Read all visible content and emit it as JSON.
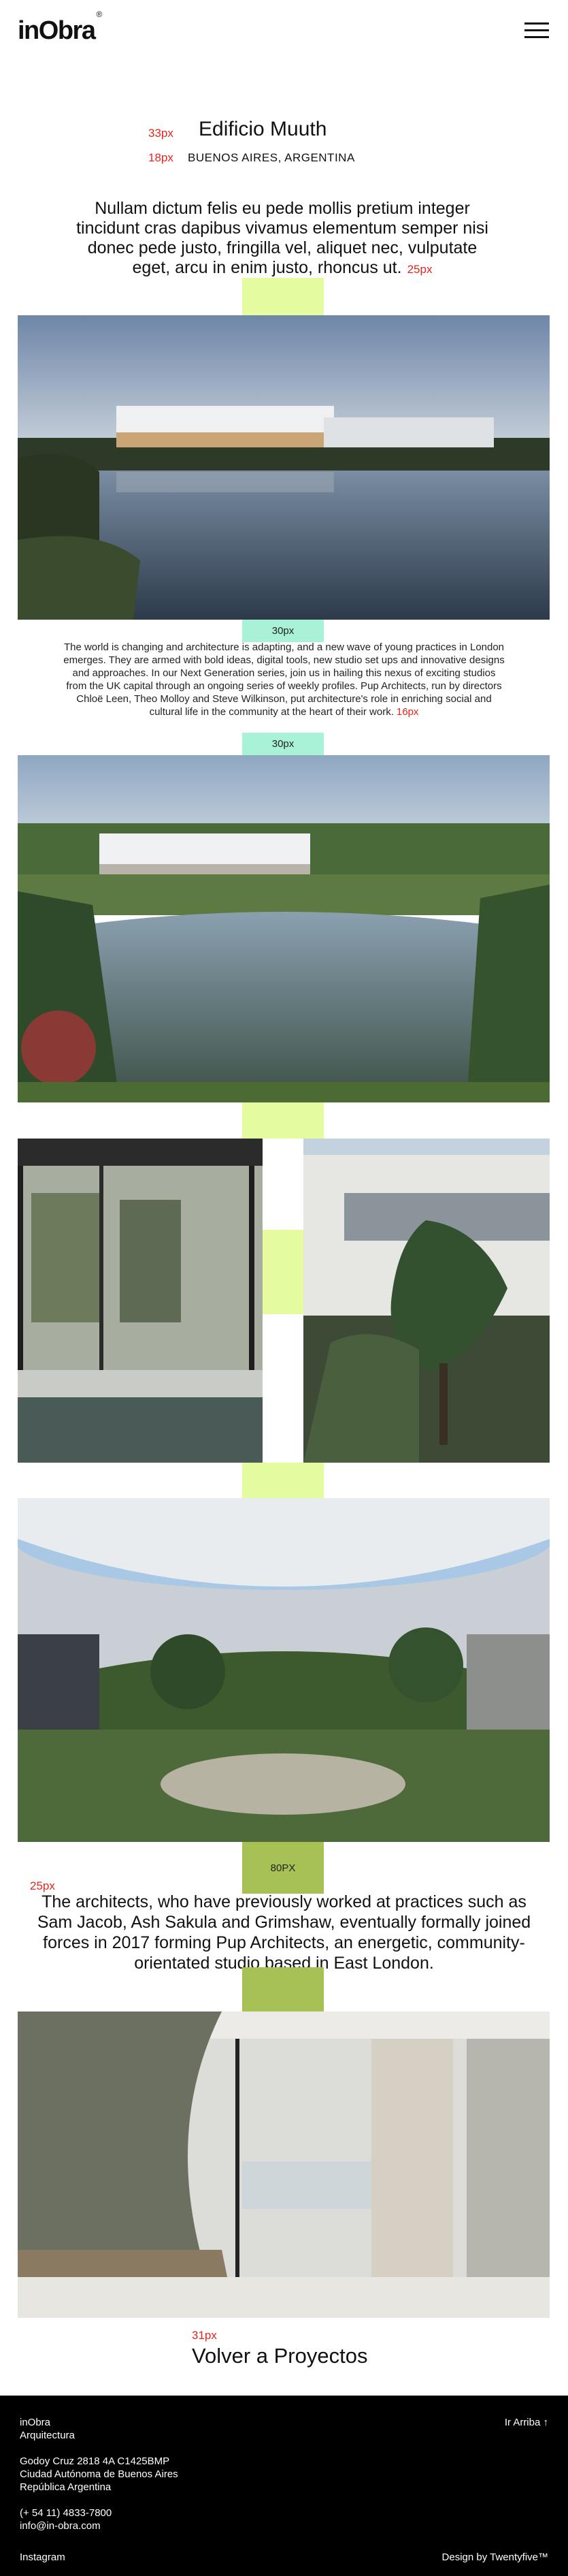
{
  "header": {
    "logo": "inObra",
    "logo_mark": "®",
    "menu_icon": "hamburger-menu-icon"
  },
  "annotations": {
    "title_size": "33px",
    "location_size": "18px",
    "lead_size": "25px",
    "body_size": "16px",
    "quote_size": "25px",
    "back_size": "31px"
  },
  "project": {
    "title": "Edificio Muuth",
    "location": "BUENOS AIRES, ARGENTINA",
    "lead": "Nullam dictum felis eu pede mollis pretium integer tincidunt cras dapibus vivamus elementum semper nisi donec pede justo, fringilla vel, aliquet nec, vulputate eget, arcu in enim justo, rhoncus ut.",
    "body": "The world is changing and architecture is adapting, and a new wave of young practices in London emerges. They are armed with bold ideas, digital tools, new studio set ups and innovative designs and approaches. In our Next Generation series, join us in hailing this nexus of exciting studios from the UK capital through an ongoing series of weekly profiles. Pup Architects, run by directors Chloë Leen, Theo Molloy and Steve Wilkinson, put architecture's role in enriching social and cultural life in the community at the heart of their work.",
    "quote": "The architects, who have previously worked at practices such as Sam Jacob, Ash Sakula and Grimshaw, eventually formally joined forces in 2017 forming Pup Architects, an energetic, community-orientated studio based in East London."
  },
  "spacers": {
    "s30a": "30px",
    "s30b": "30px",
    "s80": "80PX"
  },
  "back_link": "Volver a Proyectos",
  "footer": {
    "brand": "inObra",
    "brand_sub": "Arquitectura",
    "address1": "Godoy Cruz 2818 4A C1425BMP",
    "address2": "Ciudad Autónoma de Buenos Aires",
    "address3": "República Argentina",
    "phone": "(+ 54 11) 4833-7800",
    "email": "info@in-obra.com",
    "top_link": "Ir Arriba ↑",
    "instagram": "Instagram",
    "credit": "Design by Twentyfive™"
  },
  "colors": {
    "accent_red": "#e4261d",
    "spacer_lime": "#e4fb9f",
    "spacer_mint": "#a9f2d8",
    "spacer_olive": "#a7c155",
    "footer_bg": "#000000"
  }
}
